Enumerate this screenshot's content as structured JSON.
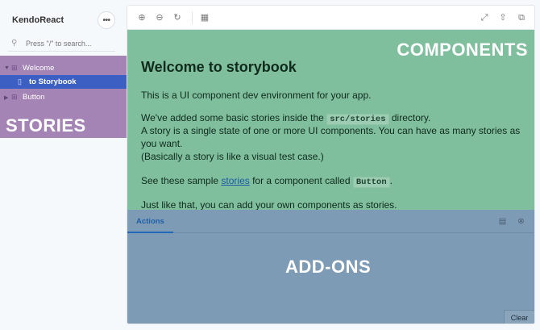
{
  "app": {
    "title": "KendoReact",
    "menu_icon": "ellipsis-icon"
  },
  "search": {
    "placeholder": "Press \"/\" to search..."
  },
  "sidebar": {
    "items": [
      {
        "label": "Welcome",
        "expanded": true
      },
      {
        "label": "to Storybook",
        "selected": true
      },
      {
        "label": "Button",
        "expanded": false
      }
    ],
    "region_label": "STORIES"
  },
  "toolbar": {
    "icons": [
      "zoom-in-icon",
      "zoom-out-icon",
      "zoom-reset-icon",
      "grid-icon",
      "fullscreen-icon",
      "share-icon",
      "copy-icon"
    ]
  },
  "preview": {
    "region_label": "COMPONENTS",
    "heading": "Welcome to storybook",
    "p1": "This is a UI component dev environment for your app.",
    "p2_a": "We've added some basic stories inside the",
    "p2_code": "src/stories",
    "p2_b": "directory.",
    "p3": "A story is a single state of one or more UI components. You can have as many stories as you want.",
    "p4": "(Basically a story is like a visual test case.)",
    "p5_a": "See these sample",
    "p5_link": "stories",
    "p5_b": "for a component called",
    "p5_code": "Button",
    "p5_c": ".",
    "p6": "Just like that, you can add your own components as stories."
  },
  "addons": {
    "tab_label": "Actions",
    "region_label": "ADD-ONS",
    "clear_label": "Clear"
  },
  "colors": {
    "stories_overlay": "#a483b5",
    "components_overlay": "#7fbf9e",
    "addons_overlay": "#7e9bb5",
    "selected_item": "#3c5fc4",
    "accent": "#1f5fa8"
  }
}
